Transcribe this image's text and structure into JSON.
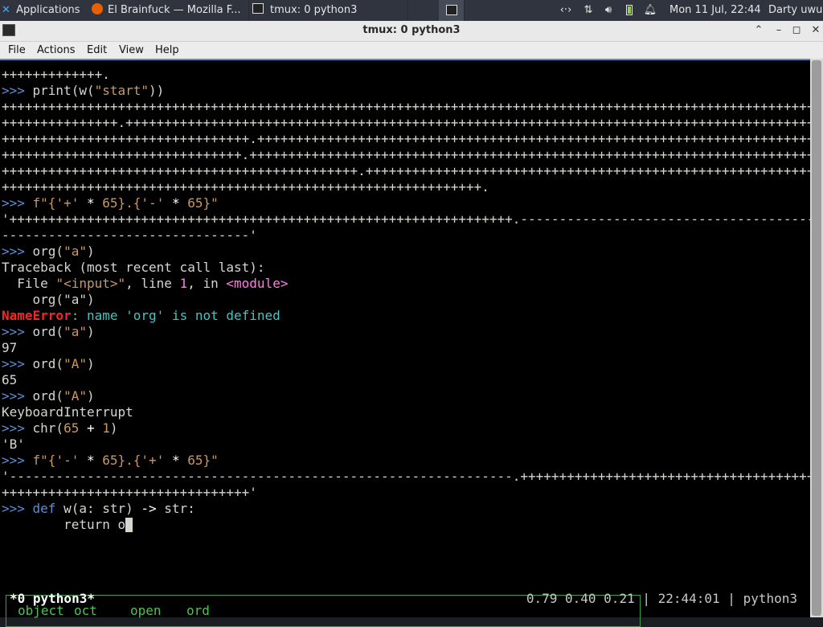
{
  "panel": {
    "apps_label": "Applications",
    "tasks": [
      {
        "label": "El Brainfuck — Mozilla F...",
        "icon": "firefox-icon"
      },
      {
        "label": "tmux: 0 python3",
        "icon": "terminal-icon"
      }
    ],
    "clock": "Mon 11 Jul, 22:44",
    "user": "Darty uwu",
    "tray_icons": [
      "network-icon",
      "transfer-arrows-icon",
      "volume-icon",
      "battery-icon",
      "bell-icon"
    ]
  },
  "window": {
    "title": "tmux: 0 python3",
    "menu": [
      "File",
      "Actions",
      "Edit",
      "View",
      "Help"
    ]
  },
  "terminal": {
    "lines": [
      [
        {
          "t": "+++++++++++++."
        }
      ],
      [
        {
          "t": ">>> ",
          "c": "p"
        },
        {
          "t": "print(w("
        },
        {
          "t": "\"start\"",
          "c": "s"
        },
        {
          "t": "))"
        }
      ],
      [
        {
          "t": "+++++++++++++++++++++++++++++++++++++++++++++++++++++++++++++++++++++++++++++++++++++++++++++++++++++++++++"
        }
      ],
      [
        {
          "t": "+++++++++++++++.+++++++++++++++++++++++++++++++++++++++++++++++++++++++++++++++++++++++++++++++++++++++++"
        }
      ],
      [
        {
          "t": "++++++++++++++++++++++++++++++++.+++++++++++++++++++++++++++++++++++++++++++++++++++++++++++++++++++++++++"
        }
      ],
      [
        {
          "t": "+++++++++++++++++++++++++++++++.++++++++++++++++++++++++++++++++++++++++++++++++++++++++++++++++++++++++++"
        }
      ],
      [
        {
          "t": "++++++++++++++++++++++++++++++++++++++++++++++.+++++++++++++++++++++++++++++++++++++++++++++++++++++++++++"
        }
      ],
      [
        {
          "t": "++++++++++++++++++++++++++++++++++++++++++++++++++++++++++++++."
        }
      ],
      [
        {
          "t": ">>> ",
          "c": "p"
        },
        {
          "t": "f\"{",
          "c": "s"
        },
        {
          "t": "'+'",
          "c": "s"
        },
        {
          "t": " * ",
          "c": "w"
        },
        {
          "t": "65",
          "c": "s"
        },
        {
          "t": "}.{",
          "c": "s"
        },
        {
          "t": "'-'",
          "c": "s"
        },
        {
          "t": " * ",
          "c": "w"
        },
        {
          "t": "65",
          "c": "s"
        },
        {
          "t": "}\"",
          "c": "s"
        }
      ],
      [
        {
          "t": "'+++++++++++++++++++++++++++++++++++++++++++++++++++++++++++++++++.---------------------------------------"
        }
      ],
      [
        {
          "t": "--------------------------------'"
        }
      ],
      [
        {
          "t": ">>> ",
          "c": "p"
        },
        {
          "t": "org("
        },
        {
          "t": "\"a\"",
          "c": "s"
        },
        {
          "t": ")"
        }
      ],
      [
        {
          "t": "Traceback (most recent call last):"
        }
      ],
      [
        {
          "t": "  File "
        },
        {
          "t": "\"<input>\"",
          "c": "s"
        },
        {
          "t": ", line "
        },
        {
          "t": "1",
          "c": "n"
        },
        {
          "t": ", in "
        },
        {
          "t": "<module>",
          "c": "n"
        }
      ],
      [
        {
          "t": "    org(\"a\")"
        }
      ],
      [
        {
          "t": "NameError",
          "c": "e"
        },
        {
          "t": ": name ",
          "c": "c"
        },
        {
          "t": "'org'",
          "c": "c"
        },
        {
          "t": " is not defined",
          "c": "c"
        }
      ],
      [
        {
          "t": ">>> ",
          "c": "p"
        },
        {
          "t": "ord("
        },
        {
          "t": "\"a\"",
          "c": "s"
        },
        {
          "t": ")"
        }
      ],
      [
        {
          "t": "97"
        }
      ],
      [
        {
          "t": ">>> ",
          "c": "p"
        },
        {
          "t": "ord("
        },
        {
          "t": "\"A\"",
          "c": "s"
        },
        {
          "t": ")"
        }
      ],
      [
        {
          "t": "65"
        }
      ],
      [
        {
          "t": ">>> ",
          "c": "p"
        },
        {
          "t": "ord("
        },
        {
          "t": "\"A\"",
          "c": "s"
        },
        {
          "t": ")"
        }
      ],
      [
        {
          "t": "KeyboardInterrupt"
        }
      ],
      [
        {
          "t": ">>> ",
          "c": "p"
        },
        {
          "t": "chr("
        },
        {
          "t": "65",
          "c": "s"
        },
        {
          "t": " + ",
          "c": "w"
        },
        {
          "t": "1",
          "c": "s"
        },
        {
          "t": ")"
        }
      ],
      [
        {
          "t": "'B'"
        }
      ],
      [
        {
          "t": ">>> ",
          "c": "p"
        },
        {
          "t": "f\"{",
          "c": "s"
        },
        {
          "t": "'-'",
          "c": "s"
        },
        {
          "t": " * ",
          "c": "w"
        },
        {
          "t": "65",
          "c": "s"
        },
        {
          "t": "}.{",
          "c": "s"
        },
        {
          "t": "'+'",
          "c": "s"
        },
        {
          "t": " * ",
          "c": "w"
        },
        {
          "t": "65",
          "c": "s"
        },
        {
          "t": "}\"",
          "c": "s"
        }
      ],
      [
        {
          "t": "'-----------------------------------------------------------------.+++++++++++++++++++++++++++++++++++++++"
        }
      ],
      [
        {
          "t": "++++++++++++++++++++++++++++++++'"
        }
      ],
      [
        {
          "t": ">>> ",
          "c": "p"
        },
        {
          "t": "def ",
          "c": "p"
        },
        {
          "t": "w(a: str) "
        },
        {
          "t": "->",
          "c": "w"
        },
        {
          "t": " str:"
        }
      ],
      [
        {
          "t": "        return o"
        }
      ]
    ],
    "completions": [
      "object",
      "oct",
      "open",
      "ord"
    ]
  },
  "tmux_status": {
    "left": "*0 python3*",
    "right": "0.79 0.40 0.21 | 22:44:01 | python3"
  }
}
